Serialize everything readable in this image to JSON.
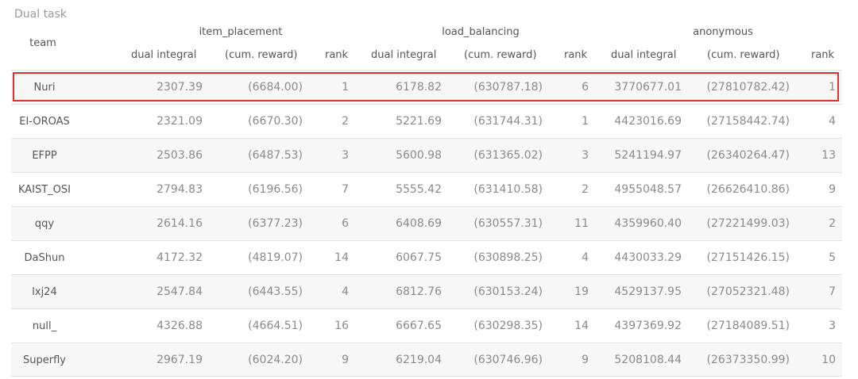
{
  "caption": "Dual task",
  "team_header": "team",
  "groups": [
    {
      "name": "item_placement"
    },
    {
      "name": "load_balancing"
    },
    {
      "name": "anonymous"
    }
  ],
  "columns": {
    "dual_integral": "dual integral",
    "cum_reward": "(cum. reward)",
    "rank": "rank"
  },
  "highlight_color": "#e03030",
  "rows": [
    {
      "team": "Nuri",
      "ip_dual": "2307.39",
      "ip_cum": "(6684.00)",
      "ip_rank": "1",
      "lb_dual": "6178.82",
      "lb_cum": "(630787.18)",
      "lb_rank": "6",
      "an_dual": "3770677.01",
      "an_cum": "(27810782.42)",
      "an_rank": "1"
    },
    {
      "team": "EI-OROAS",
      "ip_dual": "2321.09",
      "ip_cum": "(6670.30)",
      "ip_rank": "2",
      "lb_dual": "5221.69",
      "lb_cum": "(631744.31)",
      "lb_rank": "1",
      "an_dual": "4423016.69",
      "an_cum": "(27158442.74)",
      "an_rank": "4"
    },
    {
      "team": "EFPP",
      "ip_dual": "2503.86",
      "ip_cum": "(6487.53)",
      "ip_rank": "3",
      "lb_dual": "5600.98",
      "lb_cum": "(631365.02)",
      "lb_rank": "3",
      "an_dual": "5241194.97",
      "an_cum": "(26340264.47)",
      "an_rank": "13"
    },
    {
      "team": "KAIST_OSI",
      "ip_dual": "2794.83",
      "ip_cum": "(6196.56)",
      "ip_rank": "7",
      "lb_dual": "5555.42",
      "lb_cum": "(631410.58)",
      "lb_rank": "2",
      "an_dual": "4955048.57",
      "an_cum": "(26626410.86)",
      "an_rank": "9"
    },
    {
      "team": "qqy",
      "ip_dual": "2614.16",
      "ip_cum": "(6377.23)",
      "ip_rank": "6",
      "lb_dual": "6408.69",
      "lb_cum": "(630557.31)",
      "lb_rank": "11",
      "an_dual": "4359960.40",
      "an_cum": "(27221499.03)",
      "an_rank": "2"
    },
    {
      "team": "DaShun",
      "ip_dual": "4172.32",
      "ip_cum": "(4819.07)",
      "ip_rank": "14",
      "lb_dual": "6067.75",
      "lb_cum": "(630898.25)",
      "lb_rank": "4",
      "an_dual": "4430033.29",
      "an_cum": "(27151426.15)",
      "an_rank": "5"
    },
    {
      "team": "lxj24",
      "ip_dual": "2547.84",
      "ip_cum": "(6443.55)",
      "ip_rank": "4",
      "lb_dual": "6812.76",
      "lb_cum": "(630153.24)",
      "lb_rank": "19",
      "an_dual": "4529137.95",
      "an_cum": "(27052321.48)",
      "an_rank": "7"
    },
    {
      "team": "null_",
      "ip_dual": "4326.88",
      "ip_cum": "(4664.51)",
      "ip_rank": "16",
      "lb_dual": "6667.65",
      "lb_cum": "(630298.35)",
      "lb_rank": "14",
      "an_dual": "4397369.92",
      "an_cum": "(27184089.51)",
      "an_rank": "3"
    },
    {
      "team": "Superfly",
      "ip_dual": "2967.19",
      "ip_cum": "(6024.20)",
      "ip_rank": "9",
      "lb_dual": "6219.04",
      "lb_cum": "(630746.96)",
      "lb_rank": "9",
      "an_dual": "5208108.44",
      "an_cum": "(26373350.99)",
      "an_rank": "10"
    }
  ]
}
